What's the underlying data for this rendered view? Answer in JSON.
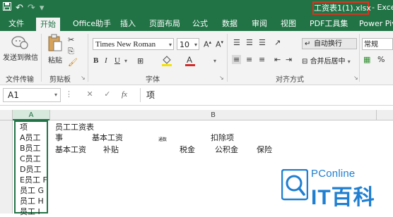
{
  "titlebar": {
    "doc_title": "工资表1(1).xlsx",
    "app_name": "- Excel",
    "qat": {
      "save_icon": "save-icon",
      "undo_icon": "undo-icon",
      "redo_icon": "redo-icon"
    }
  },
  "tabs": [
    {
      "label": "文件"
    },
    {
      "label": "开始"
    },
    {
      "label": "Office助手"
    },
    {
      "label": "插入"
    },
    {
      "label": "页面布局"
    },
    {
      "label": "公式"
    },
    {
      "label": "数据"
    },
    {
      "label": "审阅"
    },
    {
      "label": "视图"
    },
    {
      "label": "PDF工具集"
    },
    {
      "label": "Power Piv"
    }
  ],
  "ribbon": {
    "send_wechat": "发送到微信",
    "paste": "粘贴",
    "font_name": "Times New Roman",
    "font_size": "10",
    "wrap_text": "自动换行",
    "merge_center": "合并后居中",
    "number_format": "常规",
    "groups": {
      "file_transfer": "文件传输",
      "clipboard": "剪贴板",
      "font": "字体",
      "alignment": "对齐方式"
    }
  },
  "formula_bar": {
    "name_box": "A1",
    "fx_label": "fx",
    "formula": "项"
  },
  "grid": {
    "col_headers": [
      "A",
      "B"
    ],
    "col_a": [
      "项",
      "A员工",
      "B员工",
      "C员工",
      "D员工",
      "E员工 F",
      "员工 G",
      "员工 H",
      "员工 I"
    ],
    "b1": "员工工资表",
    "b2": "事",
    "b2b": "基本工资",
    "b2c": "通数",
    "b2d": "扣除项",
    "b3": [
      "基本工资",
      "补贴",
      "税金",
      "公积金",
      "保险"
    ]
  },
  "watermark": {
    "brand": "PConline",
    "site": "IT百科",
    "color": "#1f7fd0"
  }
}
